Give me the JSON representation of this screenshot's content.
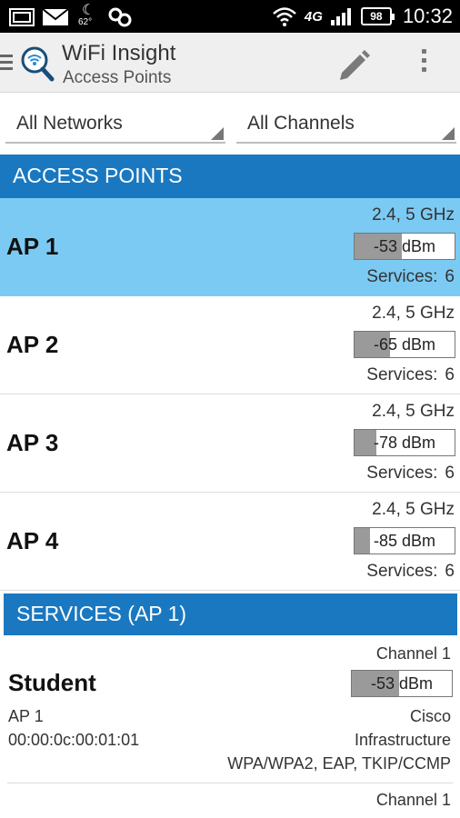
{
  "status_bar": {
    "temperature": "62°",
    "network": "4G",
    "battery": "98",
    "time": "10:32"
  },
  "action_bar": {
    "title": "WiFi Insight",
    "subtitle": "Access Points",
    "icons": [
      "menu-icon",
      "wifi-search-logo-icon",
      "pencil-icon",
      "overflow-menu-icon"
    ]
  },
  "filters": {
    "network": "All Networks",
    "channel": "All Channels"
  },
  "access_points": {
    "header": "ACCESS POINTS",
    "items": [
      {
        "name": "AP 1",
        "band": "2.4, 5 GHz",
        "signal": "-53 dBm",
        "services_label": "Services:",
        "services": "6",
        "selected": true,
        "signal_fill": 0.47
      },
      {
        "name": "AP 2",
        "band": "2.4, 5 GHz",
        "signal": "-65 dBm",
        "services_label": "Services:",
        "services": "6",
        "selected": false,
        "signal_fill": 0.35
      },
      {
        "name": "AP 3",
        "band": "2.4, 5 GHz",
        "signal": "-78 dBm",
        "services_label": "Services:",
        "services": "6",
        "selected": false,
        "signal_fill": 0.22
      },
      {
        "name": "AP 4",
        "band": "2.4, 5 GHz",
        "signal": "-85 dBm",
        "services_label": "Services:",
        "services": "6",
        "selected": false,
        "signal_fill": 0.15
      }
    ]
  },
  "services": {
    "header": "SERVICES (AP 1)",
    "items": [
      {
        "channel": "Channel 1",
        "name": "Student",
        "signal": "-53 dBm",
        "signal_fill": 0.47,
        "ap": "AP 1",
        "mac": "00:00:0c:00:01:01",
        "vendor": "Cisco",
        "mode": "Infrastructure",
        "security": "WPA/WPA2, EAP, TKIP/CCMP"
      },
      {
        "channel": "Channel 1"
      }
    ]
  },
  "colors": {
    "header_blue": "#1a78c0",
    "selected_row": "#7bcaf3",
    "meter_fill": "#9a9a9a"
  }
}
